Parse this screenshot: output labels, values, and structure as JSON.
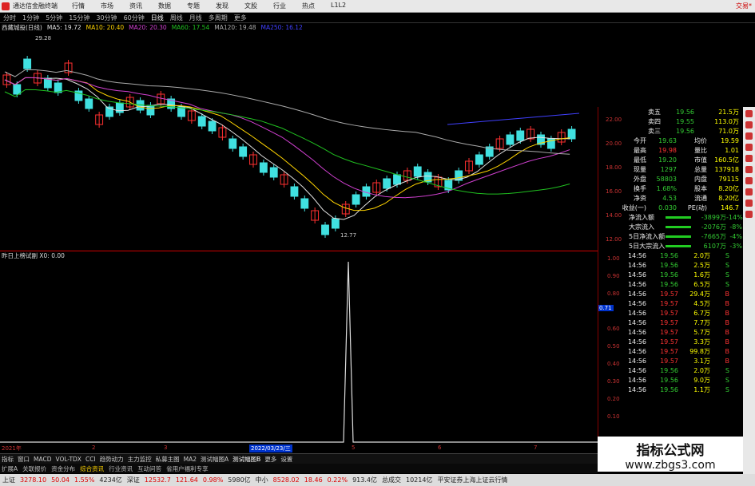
{
  "app": {
    "name": "通达信金融终端",
    "trade_label": "交易*"
  },
  "menu": [
    "行情",
    "市场",
    "资讯",
    "数据",
    "专题",
    "发现",
    "文股",
    "行业",
    "热点",
    "L1L2"
  ],
  "periods": [
    "分时",
    "1分钟",
    "5分钟",
    "15分钟",
    "30分钟",
    "60分钟",
    "日线",
    "周线",
    "月线",
    "多周期",
    "更多"
  ],
  "active_period": "日线",
  "ma_bar": {
    "stock": "西藏城投(日线)",
    "ma5": "MA5: 19.72",
    "ma10": "MA10: 20.40",
    "ma20": "MA20: 20.30",
    "ma60": "MA60: 17.54",
    "ma120": "MA120: 19.48",
    "ma250": "MA250: 16.12",
    "high_note": "29.28",
    "low_note": "12.77"
  },
  "indicator": {
    "label": "昨日上榜试副 X0: 0.00"
  },
  "price_axis": [
    "22.00",
    "20.00",
    "18.00",
    "16.00",
    "14.00",
    "12.00"
  ],
  "sub_axis": [
    "1.00",
    "0.90",
    "0.80",
    "0.71",
    "0.60",
    "0.50",
    "0.40",
    "0.30",
    "0.20",
    "0.10"
  ],
  "time_axis": {
    "year": "2021年",
    "marks": [
      "2",
      "3",
      "4",
      "5",
      "6",
      "7"
    ],
    "cursor_date": "2022/03/23/三"
  },
  "tabs": [
    "指标",
    "窗口",
    "MACD",
    "VOL-TDX",
    "CCI",
    "趋势动力",
    "主力监控",
    "私募主图",
    "MA2",
    "测试幅图A",
    "测试幅图B",
    "更多",
    "设置"
  ],
  "tabs2": [
    "扩展A",
    "关联报价",
    "资金分布",
    "综合资讯",
    "行业资讯",
    "互动问答",
    "省用户福利专享"
  ],
  "tabs2_active": "综合资讯",
  "quote": {
    "asks": [
      {
        "label": "卖五",
        "price": "19.56",
        "vol": "21.5万"
      },
      {
        "label": "卖四",
        "price": "19.55",
        "vol": "113.0万"
      },
      {
        "label": "卖三",
        "price": "19.56",
        "vol": "71.0万"
      }
    ],
    "fields": [
      {
        "l1": "今开",
        "v1": "19.63",
        "l2": "均价",
        "v2": "19.59"
      },
      {
        "l1": "最高",
        "v1": "19.98",
        "l2": "量比",
        "v2": "1.01"
      },
      {
        "l1": "最低",
        "v1": "19.20",
        "l2": "市值",
        "v2": "160.5亿"
      },
      {
        "l1": "现量",
        "v1": "1297",
        "l2": "总量",
        "v2": "137918"
      },
      {
        "l1": "外盘",
        "v1": "58803",
        "l2": "内盘",
        "v2": "79115"
      },
      {
        "l1": "换手",
        "v1": "1.68%",
        "l2": "股本",
        "v2": "8.20亿"
      },
      {
        "l1": "净资",
        "v1": "4.53",
        "l2": "流通",
        "v2": "8.20亿"
      },
      {
        "l1": "收益(一)",
        "v1": "0.030",
        "l2": "PE(动)",
        "v2": "146.7"
      }
    ],
    "flows": [
      {
        "label": "净流入额",
        "value": "-3899万",
        "pct": "-14%"
      },
      {
        "label": "大宗流入",
        "value": "-2076万",
        "pct": "-8%"
      },
      {
        "label": "5日净流入额",
        "value": "-7665万",
        "pct": "-4%"
      },
      {
        "label": "5日大宗流入",
        "value": "6107万",
        "pct": "-3%"
      }
    ],
    "ticks": [
      {
        "t": "14:56",
        "p": "19.56",
        "v": "2.0万",
        "s": "S"
      },
      {
        "t": "14:56",
        "p": "19.56",
        "v": "2.5万",
        "s": "S"
      },
      {
        "t": "14:56",
        "p": "19.56",
        "v": "1.6万",
        "s": "S"
      },
      {
        "t": "14:56",
        "p": "19.56",
        "v": "6.5万",
        "s": "S"
      },
      {
        "t": "14:56",
        "p": "19.57",
        "v": "29.4万",
        "s": "B"
      },
      {
        "t": "14:56",
        "p": "19.57",
        "v": "4.5万",
        "s": "B"
      },
      {
        "t": "14:56",
        "p": "19.57",
        "v": "6.7万",
        "s": "B"
      },
      {
        "t": "14:56",
        "p": "19.57",
        "v": "7.7万",
        "s": "B"
      },
      {
        "t": "14:56",
        "p": "19.57",
        "v": "5.7万",
        "s": "B"
      },
      {
        "t": "14:56",
        "p": "19.57",
        "v": "3.3万",
        "s": "B"
      },
      {
        "t": "14:56",
        "p": "19.57",
        "v": "99.8万",
        "s": "B"
      },
      {
        "t": "14:56",
        "p": "19.57",
        "v": "3.1万",
        "s": "B"
      },
      {
        "t": "14:56",
        "p": "19.56",
        "v": "2.0万",
        "s": "S"
      },
      {
        "t": "14:56",
        "p": "19.56",
        "v": "9.0万",
        "s": "S"
      },
      {
        "t": "14:56",
        "p": "19.56",
        "v": "1.1万",
        "s": "S"
      }
    ]
  },
  "watermark": {
    "line1": "指标公式网",
    "line2": "www.zbgs3.com"
  },
  "status": {
    "sh_label": "上证",
    "sh_val": "3278.10",
    "sh_chg": "50.04",
    "sh_pct": "1.55%",
    "sh_amt": "4234亿",
    "sz_label": "深证",
    "sz_val": "12532.7",
    "sz_chg": "121.64",
    "sz_pct": "0.98%",
    "sz_amt": "5980亿",
    "zx_label": "中小",
    "zx_val": "8528.02",
    "zx_chg": "18.46",
    "zx_pct": "0.22%",
    "zx_amt": "913.4亿",
    "total_label": "总成交",
    "total_val": "10214亿",
    "note": "平安证券上海上证云行情"
  },
  "colors": {
    "up": "#ff3030",
    "down": "#40e0e0",
    "ma5": "#e0e0e0",
    "ma10": "#ffd400",
    "ma20": "#d040d0",
    "ma60": "#20c020",
    "ma120": "#aaaaaa",
    "trend": "#4040ff"
  }
}
